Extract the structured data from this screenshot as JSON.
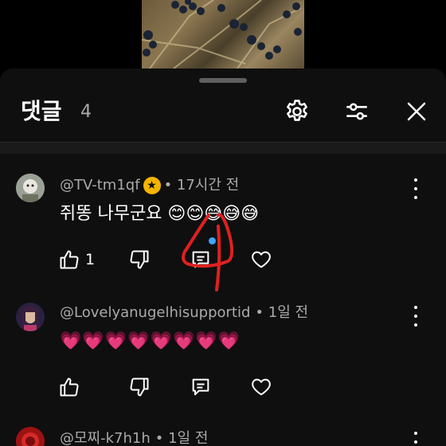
{
  "header": {
    "title": "댓글",
    "count": "4"
  },
  "comments": [
    {
      "author": "@TV-tm1qf",
      "has_badge": true,
      "time": "• 17시간 전",
      "text": "쥐똥 나무군요 😊😊😅😅😅",
      "likes": "1"
    },
    {
      "author": "@Lovelyanugelhisupportid",
      "time": "• 1일 전",
      "text": "💗💗💗💗💗💗💗💗",
      "likes": ""
    },
    {
      "author": "@모찌-k7h1h",
      "time": "• 1일 전"
    }
  ],
  "icons": {
    "settings": "gear-icon",
    "filter": "sliders-icon",
    "close": "close-icon",
    "like": "thumb-up-icon",
    "dislike": "thumb-down-icon",
    "reply": "reply-icon",
    "heart": "heart-icon",
    "more": "more-vert-icon"
  },
  "colors": {
    "background": "#0f0f0f",
    "secondary_text": "#aaaaaa",
    "annotation": "#e02020",
    "notification_dot": "#3ea6ff"
  }
}
